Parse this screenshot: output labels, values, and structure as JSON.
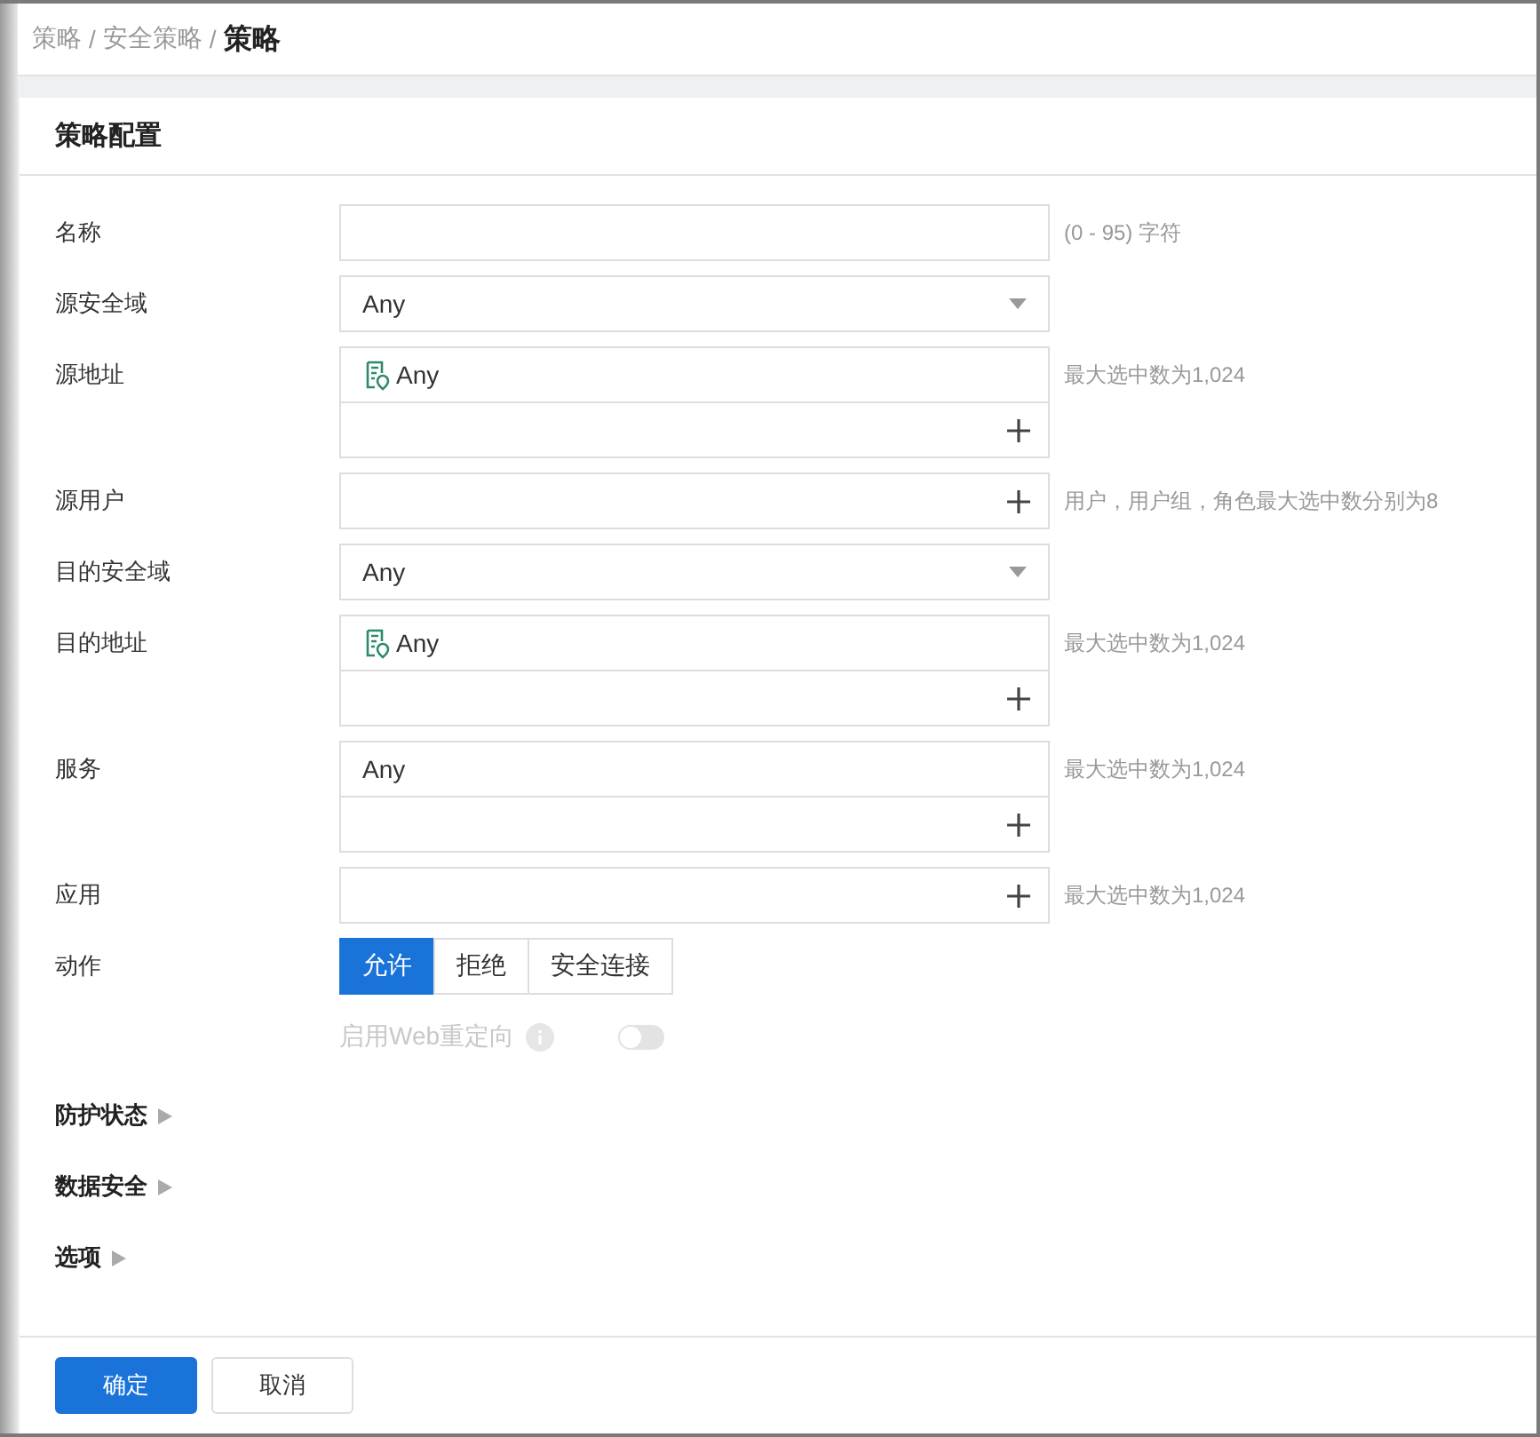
{
  "breadcrumb_separator": "/",
  "breadcrumb": [
    {
      "label": "策略",
      "current": false
    },
    {
      "label": "安全策略",
      "current": false
    },
    {
      "label": "策略",
      "current": true
    }
  ],
  "card": {
    "title": "策略配置"
  },
  "rows": [
    {
      "label": "名称",
      "kind": "text",
      "hint": "(0 - 95) 字符"
    },
    {
      "label": "源安全域",
      "kind": "select",
      "value": "Any"
    },
    {
      "label": "源地址",
      "kind": "list",
      "items": [
        {
          "text": "Any",
          "kind": "address"
        }
      ],
      "hint": "最大选中数为1,024"
    },
    {
      "label": "源用户",
      "kind": "add",
      "hint": "用户，用户组，角色最大选中数分别为8"
    },
    {
      "label": "目的安全域",
      "kind": "select",
      "value": "Any"
    },
    {
      "label": "目的地址",
      "kind": "list",
      "items": [
        {
          "text": "Any",
          "kind": "address"
        }
      ],
      "hint": "最大选中数为1,024"
    },
    {
      "label": "服务",
      "kind": "list",
      "items": [
        {
          "text": "Any",
          "kind": "plain"
        }
      ],
      "hint": "最大选中数为1,024"
    },
    {
      "label": "应用",
      "kind": "add",
      "hint": "最大选中数为1,024"
    },
    {
      "label": "动作",
      "kind": "segmented",
      "options": [
        {
          "label": "允许",
          "selected": true
        },
        {
          "label": "拒绝",
          "selected": false
        },
        {
          "label": "安全连接",
          "selected": false
        }
      ]
    }
  ],
  "redirect": {
    "label": "启用Web重定向",
    "disabled": true,
    "on": false
  },
  "sections": [
    {
      "label": "防护状态",
      "expanded": false
    },
    {
      "label": "数据安全",
      "expanded": false
    },
    {
      "label": "选项",
      "expanded": false
    }
  ],
  "buttons": [
    {
      "label": "确定",
      "kind": "primary"
    },
    {
      "label": "取消",
      "kind": "default"
    }
  ]
}
